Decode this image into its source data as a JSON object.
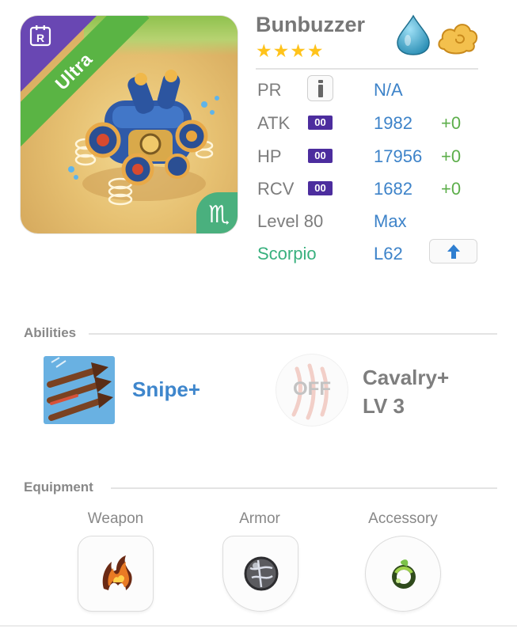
{
  "monster": {
    "name": "Bunbuzzer",
    "rarity_label": "Ultra",
    "stars": "★★★★",
    "rank_badge": "R",
    "zodiac_glyph": "♏",
    "elements": [
      "water-drop-icon",
      "cloud-icon"
    ]
  },
  "stats": {
    "pr": {
      "label": "PR",
      "value": "N/A"
    },
    "atk": {
      "label": "ATK",
      "badge": "00",
      "value": "1982",
      "bonus": "+0"
    },
    "hp": {
      "label": "HP",
      "badge": "00",
      "value": "17956",
      "bonus": "+0"
    },
    "rcv": {
      "label": "RCV",
      "badge": "00",
      "value": "1682",
      "bonus": "+0"
    },
    "level": {
      "label": "Level 80",
      "value": "Max"
    },
    "zodiac": {
      "label": "Scorpio",
      "value": "L62"
    }
  },
  "abilities": {
    "title": "Abilities",
    "items": [
      {
        "name": "Snipe+",
        "icon": "triple-arrow-icon"
      },
      {
        "name": "Cavalry+",
        "level": "LV 3",
        "state": "OFF",
        "icon": "claw-icon"
      }
    ]
  },
  "equipment": {
    "title": "Equipment",
    "slots": [
      {
        "label": "Weapon",
        "icon": "flame-claw-icon"
      },
      {
        "label": "Armor",
        "icon": "stone-orb-icon"
      },
      {
        "label": "Accessory",
        "icon": "leaf-ring-icon"
      }
    ]
  },
  "colors": {
    "value_blue": "#3d83c9",
    "bonus_green": "#5cae4a",
    "scorpio_green": "#38b07e",
    "ultra_green": "#5ab444",
    "corner_purple": "#6947b3",
    "star_gold": "#ffc31b",
    "badge_purple": "#4c2d9e"
  }
}
